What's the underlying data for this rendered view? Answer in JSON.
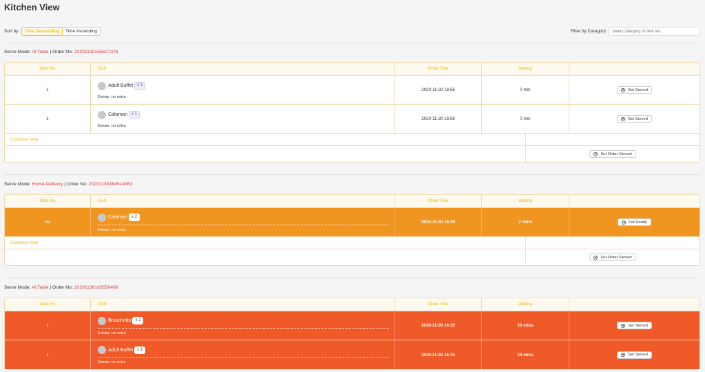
{
  "page": {
    "title": "Kitchen View"
  },
  "sort": {
    "label": "Sort by",
    "options": [
      "Time Descending",
      "Time Ascending"
    ],
    "selected": "Time Descending"
  },
  "filter": {
    "label": "Filter by Category",
    "placeholder": "Select category to filter list."
  },
  "columns": [
    "Table No.",
    "Dish",
    "Order Time",
    "Waiting",
    ""
  ],
  "orders": [
    {
      "serve_mode_label": "Serve Mode:",
      "serve_mode": "At Table",
      "order_no_label": "| Order No:",
      "order_no": "20201130165627376",
      "items": [
        {
          "table": "1",
          "dish": "Adult Buffet",
          "qty": "x 1",
          "extras": "Extras:  no extra",
          "time": "2020-11-30 16:56",
          "waiting": "0 min",
          "action": "Set Served"
        },
        {
          "table": "1",
          "dish": "Calamari",
          "qty": "x 1",
          "extras": "Extras:  no extra",
          "time": "2020-11-30 16:56",
          "waiting": "0 min",
          "action": "Set Served"
        }
      ],
      "customer_note_label": "Customer Note",
      "order_action": "Set Order Served"
    },
    {
      "serve_mode_label": "Serve Mode:",
      "serve_mode": "Home-Delivery",
      "order_no_label": "| Order No:",
      "order_no": "20201130164914563",
      "items": [
        {
          "table": "n/a",
          "dish": "Calamari",
          "qty": "x 2",
          "extras": "Extras:  no extra",
          "time": "2020-11-30 16:49",
          "waiting": "7 mins",
          "action": "Set Ready"
        }
      ],
      "customer_note_label": "Customer Note",
      "order_action": "Set Order Served"
    },
    {
      "serve_mode_label": "Serve Mode:",
      "serve_mode": "At Table",
      "order_no_label": "| Order No:",
      "order_no": "20201130163556468",
      "items": [
        {
          "table": "1",
          "dish": "Bruschetta",
          "qty": "x 2",
          "extras": "Extras:  no extra",
          "time": "2020-11-30 16:35",
          "waiting": "20 mins",
          "action": "Set Served"
        },
        {
          "table": "1",
          "dish": "Adult Buffet",
          "qty": "x 1",
          "extras": "Extras:  no extra",
          "time": "2020-11-30 16:35",
          "waiting": "20 mins",
          "action": "Set Served"
        }
      ]
    }
  ],
  "colors": {
    "accent": "#f3c300",
    "order_no": "#e23b3b",
    "ready_orange": "#f09520",
    "overdue_red": "#f05a28"
  }
}
